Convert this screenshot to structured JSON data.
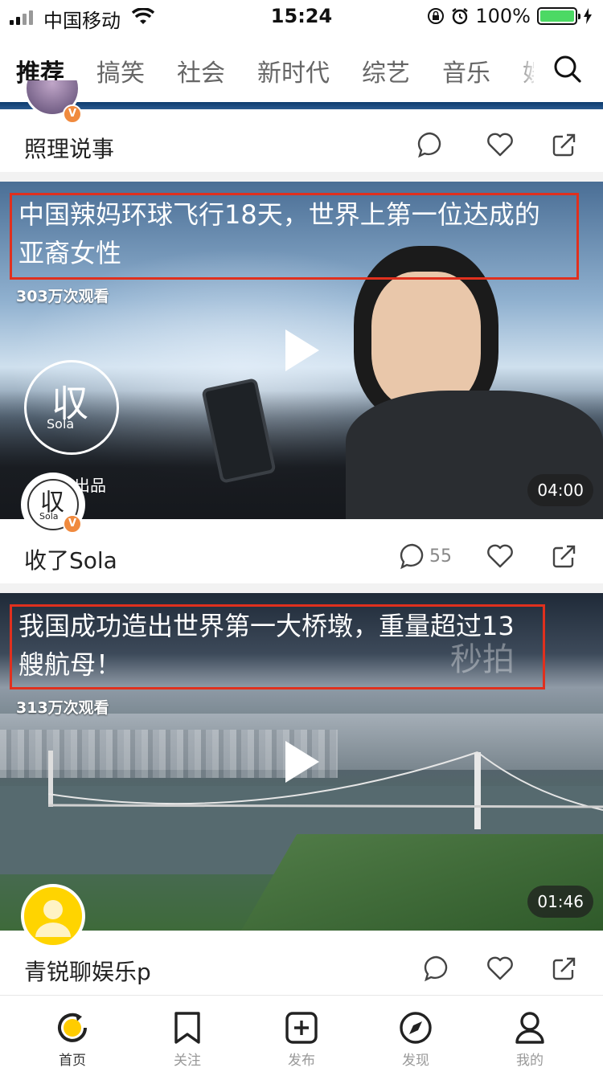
{
  "status_bar": {
    "carrier": "中国移动",
    "time": "15:24",
    "battery": "100%"
  },
  "tabs": [
    {
      "label": "推荐"
    },
    {
      "label": "搞笑"
    },
    {
      "label": "社会"
    },
    {
      "label": "新时代"
    },
    {
      "label": "综艺"
    },
    {
      "label": "音乐"
    },
    {
      "label": "娱"
    }
  ],
  "cards": [
    {
      "author": "照理说事"
    },
    {
      "title_line1": "中国辣妈环球飞行18天，世界上第一位达成的",
      "title_line2": "亚裔女性",
      "views": "303万次观看",
      "duration": "04:00",
      "overlay_text": "出品",
      "author": "收了Sola",
      "comment_count": "55"
    },
    {
      "title_line1": "我国成功造出世界第一大桥墩，重量超过13",
      "title_line2": "艘航母！",
      "views": "313万次观看",
      "duration": "01:46",
      "watermark": "秒拍",
      "author": "青锐聊娱乐p"
    }
  ],
  "bottom_nav": [
    {
      "label": "首页"
    },
    {
      "label": "关注"
    },
    {
      "label": "发布"
    },
    {
      "label": "发现"
    },
    {
      "label": "我的"
    }
  ],
  "colors": {
    "accent": "#ffcc00",
    "highlight_box": "#e0301e",
    "v_badge": "#f08a3e",
    "battery": "#4cd964"
  }
}
